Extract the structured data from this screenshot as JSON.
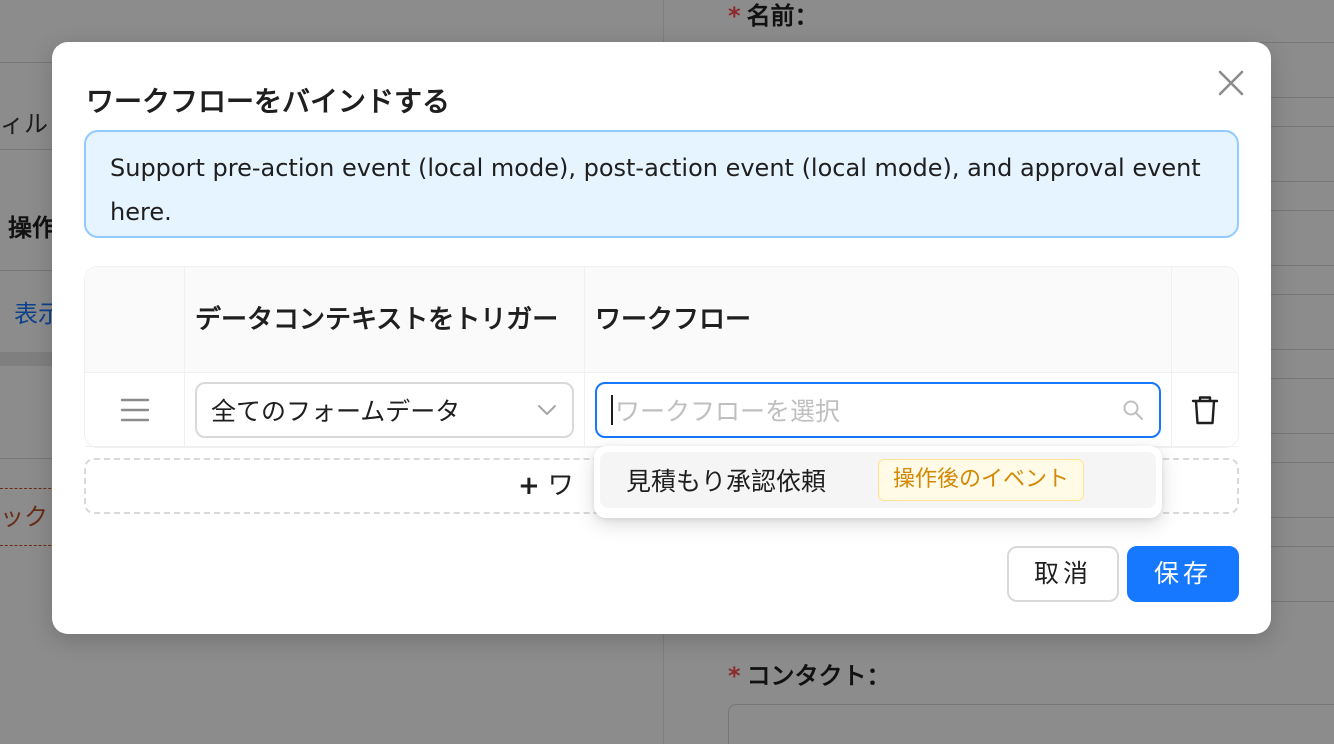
{
  "background": {
    "left": {
      "filter_text": "ィル",
      "section_title": "操作",
      "tab_label": "表示",
      "link_text": "ック"
    },
    "right": {
      "required_mark": "*",
      "field_name_label": "名前：",
      "field_contact_label": "コンタクト："
    }
  },
  "modal": {
    "title": "ワークフローをバインドする",
    "alert_text": "Support pre-action event (local mode), post-action event (local mode), and approval event here.",
    "table": {
      "headers": [
        "",
        "データコンテキストをトリガー",
        "ワークフロー",
        ""
      ],
      "rows": [
        {
          "context_select_value": "全てのフォームデータ",
          "workflow_placeholder": "ワークフローを選択"
        }
      ]
    },
    "add_button_label": "ワークフローを追加",
    "add_button_visible": "ワ",
    "dropdown": {
      "options": [
        {
          "label": "見積もり承認依頼",
          "tag": "操作後のイベント"
        }
      ]
    },
    "cancel_label": "取消",
    "save_label": "保存"
  },
  "colors": {
    "primary": "#1677ff",
    "alert_bg": "#e6f4ff",
    "alert_border": "#91caff",
    "tag_text": "#d48806",
    "tag_bg": "#fffbe6",
    "required": "#ff4d4f"
  }
}
